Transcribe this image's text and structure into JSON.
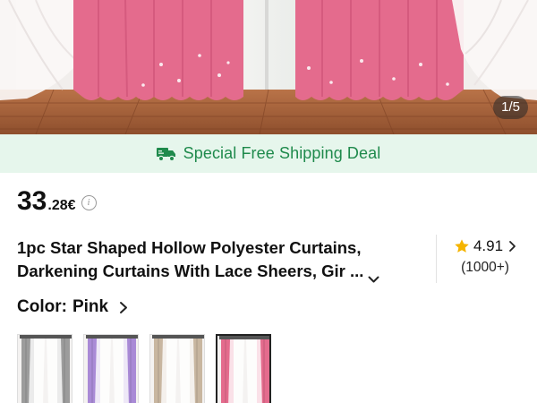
{
  "hero": {
    "counter": "1/5",
    "curtain_color": "#e46b8d",
    "sheer_color": "#fbf7f6",
    "floor_color": "#a4603a"
  },
  "shipping": {
    "text": "Special Free Shipping Deal",
    "icon": "truck-icon",
    "color": "#1f8a4c",
    "background": "#e6f6ec"
  },
  "price": {
    "integer": "33",
    "decimal": ".28",
    "currency": "€",
    "info_icon": "info-icon"
  },
  "product": {
    "title_line1": "1pc Star Shaped Hollow Polyester Curtains,",
    "title_line2": "Darkening Curtains With Lace Sheers, Gir ...",
    "expand_icon": "chevron-down-icon"
  },
  "rating": {
    "value": "4.91",
    "count": "(1000+)",
    "star_color": "#f5b400"
  },
  "color_option": {
    "label": "Color:",
    "value": "Pink",
    "swatches": [
      {
        "name": "Grey",
        "color": "#9c9c9c",
        "selected": false
      },
      {
        "name": "Purple",
        "color": "#a98ad6",
        "selected": false
      },
      {
        "name": "Beige",
        "color": "#c8b6a0",
        "selected": false
      },
      {
        "name": "Pink",
        "color": "#e46b8d",
        "selected": true
      }
    ]
  }
}
